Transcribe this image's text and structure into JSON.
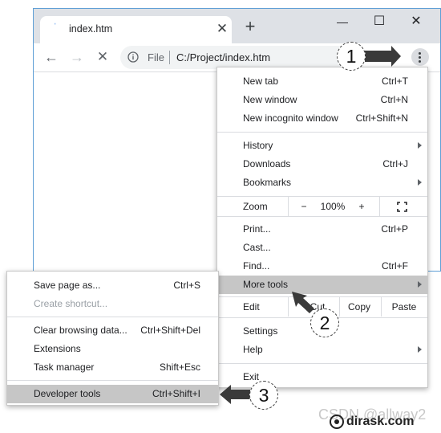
{
  "browser": {
    "tab_title": "index.htm",
    "tab_close": "✕",
    "new_tab": "+",
    "window_controls": {
      "minimize": "—",
      "maximize": "☐",
      "close": "✕"
    },
    "nav": {
      "back": "←",
      "forward": "→",
      "reload": "✕"
    },
    "omnibox": {
      "scheme": "File",
      "url": "C:/Project/index.htm"
    }
  },
  "menu": {
    "group1": [
      {
        "label": "New tab",
        "shortcut": "Ctrl+T"
      },
      {
        "label": "New window",
        "shortcut": "Ctrl+N"
      },
      {
        "label": "New incognito window",
        "shortcut": "Ctrl+Shift+N"
      }
    ],
    "group2": [
      {
        "label": "History",
        "shortcut": ""
      },
      {
        "label": "Downloads",
        "shortcut": "Ctrl+J"
      },
      {
        "label": "Bookmarks",
        "shortcut": ""
      }
    ],
    "zoom": {
      "label": "Zoom",
      "minus": "−",
      "value": "100%",
      "plus": "+",
      "fullscreen": "⛶"
    },
    "group3": [
      {
        "label": "Print...",
        "shortcut": "Ctrl+P"
      },
      {
        "label": "Cast...",
        "shortcut": ""
      },
      {
        "label": "Find...",
        "shortcut": "Ctrl+F"
      },
      {
        "label": "More tools",
        "shortcut": ""
      }
    ],
    "edit": {
      "label": "Edit",
      "cut": "Cut",
      "copy": "Copy",
      "paste": "Paste"
    },
    "group4": [
      {
        "label": "Settings",
        "shortcut": ""
      },
      {
        "label": "Help",
        "shortcut": ""
      }
    ],
    "exit": {
      "label": "Exit"
    }
  },
  "submenu": {
    "items": [
      {
        "label": "Save page as...",
        "shortcut": "Ctrl+S"
      },
      {
        "label": "Create shortcut...",
        "shortcut": ""
      },
      {
        "label": "Clear browsing data...",
        "shortcut": "Ctrl+Shift+Del"
      },
      {
        "label": "Extensions",
        "shortcut": ""
      },
      {
        "label": "Task manager",
        "shortcut": "Shift+Esc"
      },
      {
        "label": "Developer tools",
        "shortcut": "Ctrl+Shift+I"
      }
    ]
  },
  "callouts": {
    "step1": "1",
    "step2": "2",
    "step3": "3"
  },
  "watermark": {
    "brand": "dirask.com",
    "ghost": "CSDN @allway2"
  },
  "colors": {
    "highlight": "#c6c6c6",
    "window_border": "#5f9fd6",
    "titlebar": "#dee1e6"
  }
}
